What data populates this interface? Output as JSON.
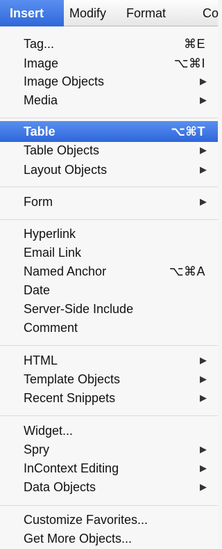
{
  "menubar": {
    "items": [
      "Insert",
      "Modify",
      "Format",
      "Co"
    ]
  },
  "menu": {
    "items": [
      {
        "label": "Tag...",
        "shortcut": "⌘E"
      },
      {
        "label": "Image",
        "shortcut": "⌥⌘I"
      },
      {
        "label": "Image Objects",
        "submenu_icon": "right-triangle-icon"
      },
      {
        "label": "Media",
        "submenu_icon": "right-triangle-icon"
      },
      {
        "label": "Table",
        "shortcut": "⌥⌘T",
        "highlighted": true
      },
      {
        "label": "Table Objects",
        "submenu_icon": "right-triangle-icon"
      },
      {
        "label": "Layout Objects",
        "submenu_icon": "right-triangle-icon"
      },
      {
        "label": "Form",
        "submenu_icon": "right-triangle-icon"
      },
      {
        "label": "Hyperlink"
      },
      {
        "label": "Email Link"
      },
      {
        "label": "Named Anchor",
        "shortcut": "⌥⌘A"
      },
      {
        "label": "Date"
      },
      {
        "label": "Server-Side Include"
      },
      {
        "label": "Comment"
      },
      {
        "label": "HTML",
        "submenu_icon": "right-triangle-icon"
      },
      {
        "label": "Template Objects",
        "submenu_icon": "right-triangle-icon"
      },
      {
        "label": "Recent Snippets",
        "submenu_icon": "right-triangle-icon"
      },
      {
        "label": "Widget..."
      },
      {
        "label": "Spry",
        "submenu_icon": "right-triangle-icon"
      },
      {
        "label": "InContext Editing",
        "submenu_icon": "right-triangle-icon"
      },
      {
        "label": "Data Objects",
        "submenu_icon": "right-triangle-icon"
      },
      {
        "label": "Customize Favorites..."
      },
      {
        "label": "Get More Objects..."
      }
    ],
    "arrow_glyph": "▶"
  },
  "colors": {
    "highlight": "#3a74e2",
    "menu_bg": "#f7f7f7"
  }
}
